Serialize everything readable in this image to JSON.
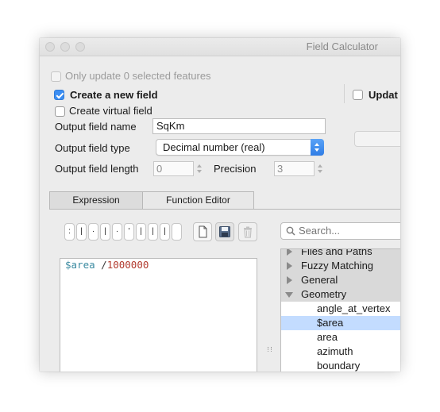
{
  "window": {
    "title": "Field Calculator"
  },
  "options": {
    "only_update_selected": "Only update 0 selected features",
    "create_new_field": "Create a new field",
    "update_existing_field": "Updat",
    "create_virtual_field": "Create virtual field"
  },
  "fields": {
    "output_name_label": "Output field name",
    "output_name_value": "SqKm",
    "output_type_label": "Output field type",
    "output_type_value": "Decimal number (real)",
    "output_length_label": "Output field length",
    "output_length_value": "0",
    "precision_label": "Precision",
    "precision_value": "3"
  },
  "tabs": [
    {
      "label": "Expression"
    },
    {
      "label": "Function Editor"
    }
  ],
  "operators": [
    ":",
    "|",
    "·",
    "|",
    "·",
    "'",
    "|",
    "|",
    "|"
  ],
  "expression": {
    "variable": "$area",
    "operator": " /",
    "number": "1000000"
  },
  "search": {
    "placeholder": "Search..."
  },
  "tree": {
    "groups": [
      "Files and Paths",
      "Fuzzy Matching",
      "General",
      "Geometry"
    ],
    "items": [
      "angle_at_vertex",
      "$area",
      "area",
      "azimuth",
      "boundary"
    ]
  },
  "colors": {
    "accent": "#3b8ef3",
    "selection": "#c3dcff",
    "expr_variable": "#3a8aa0",
    "expr_number": "#b23a2e"
  }
}
